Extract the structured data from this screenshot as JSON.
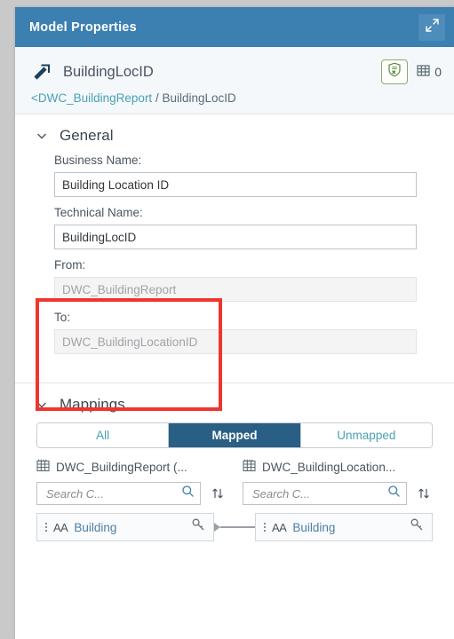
{
  "window": {
    "title": "Model Properties",
    "expand_icon": "expand-icon",
    "header_bg": "#3c7fb1"
  },
  "object_header": {
    "icon": "association-arrow-icon",
    "title": "BuildingLocID",
    "validation_icon": "shield-check-icon",
    "records_icon": "table-icon",
    "records_count": "0",
    "breadcrumb": {
      "parent": "<DWC_BuildingReport",
      "separator": "/",
      "current": "BuildingLocID"
    }
  },
  "general": {
    "chevron": "chevron-down-icon",
    "title": "General",
    "fields": [
      {
        "label": "Business Name:",
        "value": "Building Location ID",
        "placeholder": "",
        "disabled": false,
        "name": "business-name"
      },
      {
        "label": "Technical Name:",
        "value": "BuildingLocID",
        "placeholder": "",
        "disabled": false,
        "name": "technical-name"
      },
      {
        "label": "From:",
        "value": "DWC_BuildingReport",
        "placeholder": "",
        "disabled": true,
        "name": "from"
      },
      {
        "label": "To:",
        "value": "DWC_BuildingLocationID",
        "placeholder": "",
        "disabled": true,
        "name": "to"
      }
    ]
  },
  "annotation": {
    "color": "#f0352f",
    "type": "highlight-rectangle"
  },
  "mappings": {
    "chevron": "chevron-down-icon",
    "title": "Mappings",
    "filters": [
      {
        "label": "All",
        "active": false
      },
      {
        "label": "Mapped",
        "active": true
      },
      {
        "label": "Unmapped",
        "active": false
      }
    ],
    "active_filter_color": "#2a5f85",
    "source": {
      "icon": "table-icon",
      "header": "DWC_BuildingReport (...",
      "search_placeholder": "Search C...",
      "search_value": "",
      "search_icon": "search-icon",
      "sort_icon": "sort-icon",
      "row": {
        "drag_icon": "drag-handle-icon",
        "type_icon": "AA",
        "label": "Building",
        "key_icon": "key-icon"
      }
    },
    "target": {
      "icon": "table-icon",
      "header": "DWC_BuildingLocation...",
      "search_placeholder": "Search C...",
      "search_value": "",
      "search_icon": "search-icon",
      "sort_icon": "sort-icon",
      "row": {
        "drag_icon": "drag-handle-icon",
        "type_icon": "AA",
        "label": "Building",
        "key_icon": "key-icon"
      }
    },
    "connector": "mapping-link-line"
  }
}
